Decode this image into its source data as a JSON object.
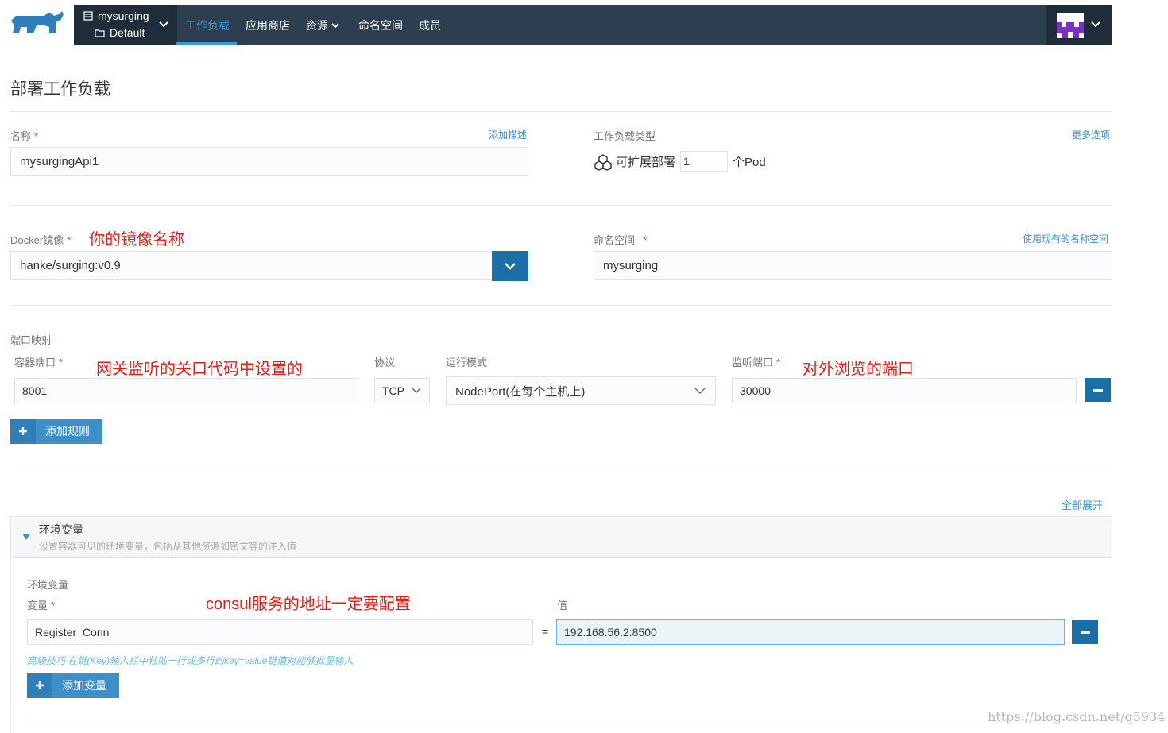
{
  "header": {
    "cluster": "mysurging",
    "project": "Default",
    "nav": [
      {
        "label": "工作负载",
        "active": true
      },
      {
        "label": "应用商店"
      },
      {
        "label": "资源"
      },
      {
        "label": "命名空间"
      },
      {
        "label": "成员"
      }
    ]
  },
  "page": {
    "title": "部署工作负载"
  },
  "form": {
    "name_label": "名称",
    "required_mark": "*",
    "add_description": "添加描述",
    "name_value": "mysurgingApi1",
    "workload_type_label": "工作负载类型",
    "more_options": "更多选项",
    "workload_type": "可扩展部署",
    "pod_count": "1",
    "pod_unit": "个Pod",
    "docker_label": "Docker镜像",
    "docker_value": "hanke/surging:v0.9",
    "namespace_label": "命名空间",
    "use_existing_namespace": "使用现有的名称空间",
    "namespace_value": "mysurging",
    "port_mapping_label": "端口映射",
    "container_port_label": "容器端口",
    "protocol_label": "协议",
    "mode_label": "运行模式",
    "listen_port_label": "监听端口",
    "container_port": "8001",
    "protocol": "TCP",
    "mode": "NodePort(在每个主机上)",
    "listen_port": "30000",
    "add_rule": "添加规则",
    "expand_all": "全部展开",
    "env_title": "环境变量",
    "env_desc": "设置容器可见的环境变量，包括从其他资源如密文等的注入值",
    "env_sub": "环境变量",
    "var_label": "变量",
    "val_label": "值",
    "var_key": "Register_Conn",
    "equals": "=",
    "var_value": "192.168.56.2:8500",
    "tip": "高级技巧 在键(Key)输入栏中粘贴一行或多行的key=value键值对能够批量输入",
    "add_var": "添加变量"
  },
  "annotations": {
    "image_name": "你的镜像名称",
    "gateway_port": "网关监听的关口代码中设置的",
    "external_port": "对外浏览的端口",
    "consul": "consul服务的地址一定要配置"
  },
  "watermark": "https://blog.csdn.net/q5934",
  "colors": {
    "nav_bg": "#2c3e50",
    "accent": "#3d98d3",
    "button": "#1a6fa6",
    "annotation": "#e0201a"
  }
}
